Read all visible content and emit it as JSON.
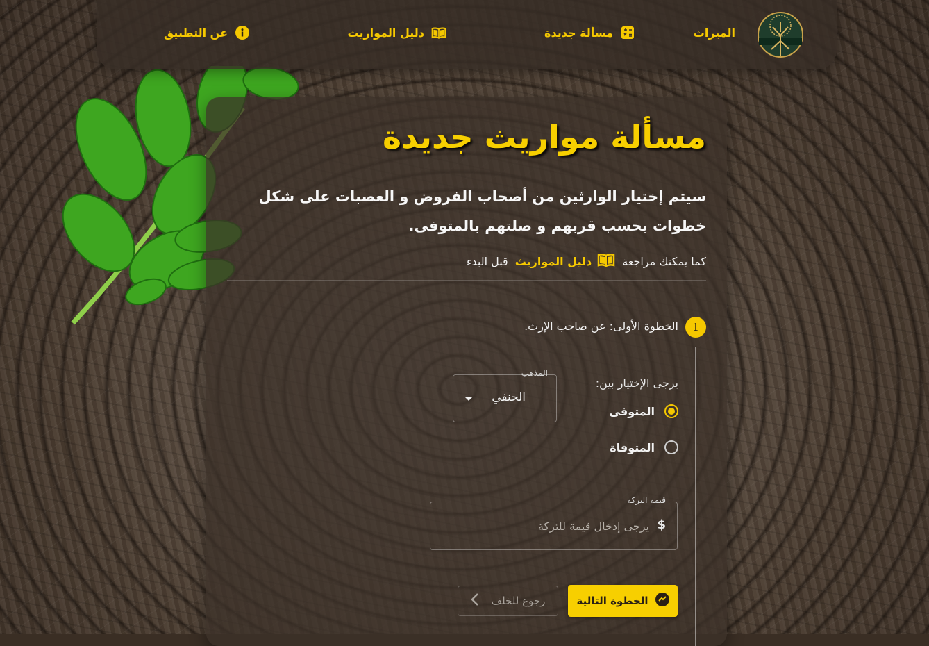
{
  "nav": {
    "brand": "الميراث",
    "new_problem": "مسألة جديدة",
    "guide": "دليل المواريث",
    "about": "عن التطبيق"
  },
  "main": {
    "title": "مسألة مواريث جديدة",
    "intro": "سيتم إختيار الوارثين من أصحاب الفروض و العصبات على شكل خطوات بحسب قربهم و صلتهم بالمتوفى.",
    "review_prefix": "كما يمكنك مراجعة",
    "review_link": "دليل المواريث",
    "review_suffix": "قبل البدء"
  },
  "step": {
    "number": "1",
    "label": "الخطوة الأولى: عن صاحب الإرث.",
    "choose_label": "يرجى الإختيار بين:",
    "options": [
      {
        "label": "المتوفى",
        "selected": true
      },
      {
        "label": "المتوفاة",
        "selected": false
      }
    ],
    "madhhab": {
      "legend": "المذهب",
      "value": "الحنفي"
    },
    "estate": {
      "legend": "قيمة التركة",
      "currency": "$",
      "placeholder": "يرجى إدخال قيمة للتركة"
    },
    "next_label": "الخطوة التالية",
    "back_label": "رجوع للخلف"
  },
  "colors": {
    "accent": "#f7cf00",
    "card": "#3c3028"
  }
}
